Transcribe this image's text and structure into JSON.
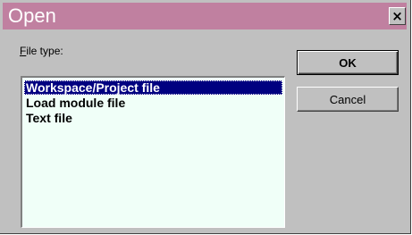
{
  "window": {
    "title": "Open",
    "close_glyph": "×",
    "close_icon": "close-icon"
  },
  "file_type": {
    "label_accel": "F",
    "label_rest": "ile type:",
    "options": [
      "Workspace/Project file",
      "Load module file",
      "Text file"
    ],
    "selected_index": 0
  },
  "buttons": {
    "ok_label": "OK",
    "cancel_label": "Cancel"
  },
  "colors": {
    "titlebar": "#c080a0",
    "selection": "#000080",
    "listbox_bg": "#f0fff8"
  }
}
